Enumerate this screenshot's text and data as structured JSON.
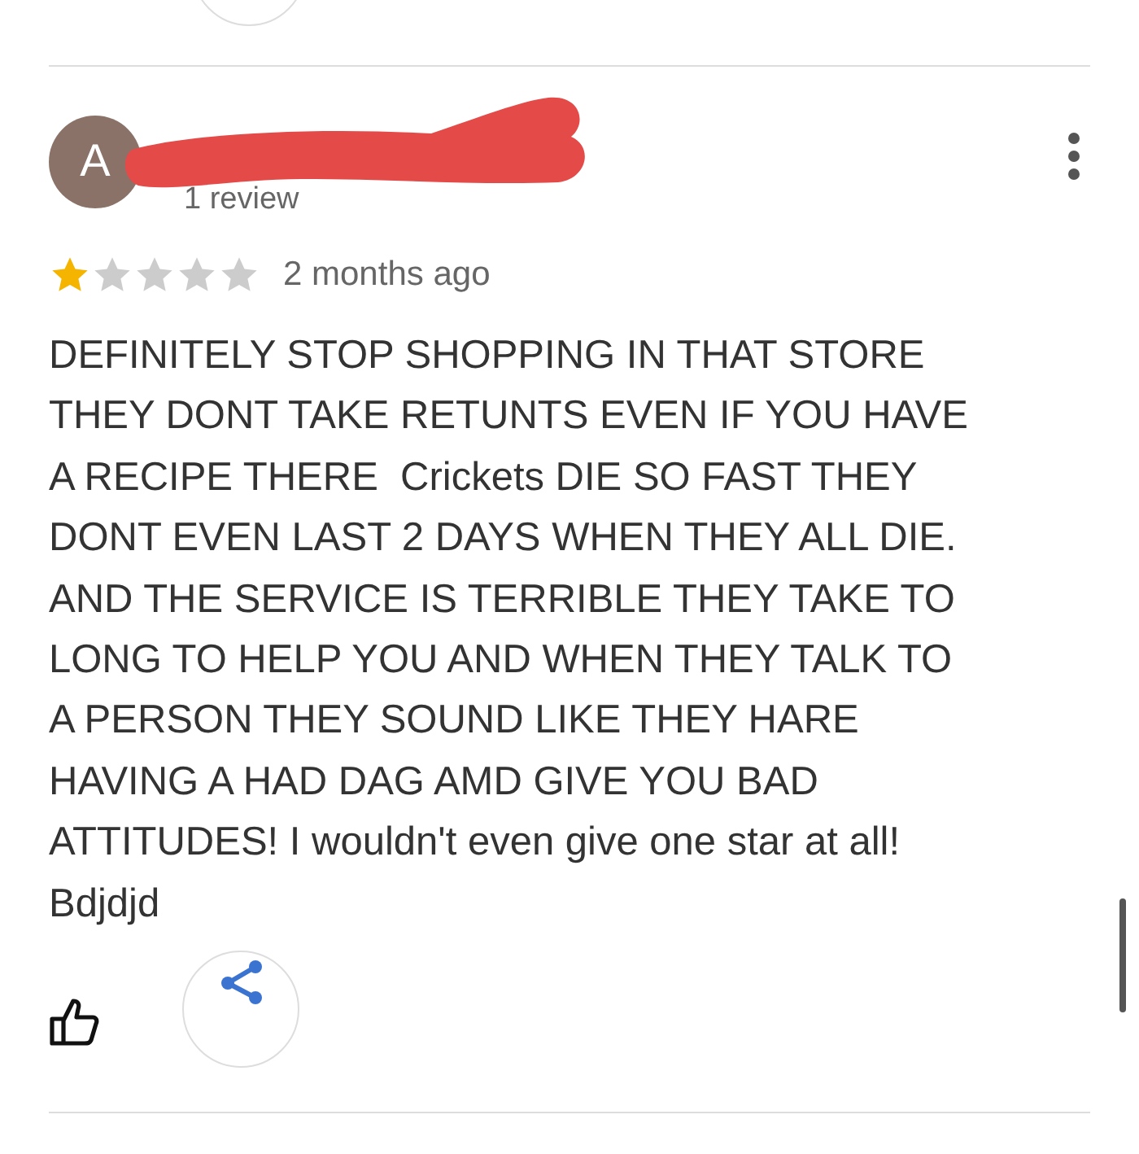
{
  "review": {
    "avatar_letter": "A",
    "review_count": "1 review",
    "stars": 1,
    "time": "2 months ago",
    "text": "DEFINITELY STOP SHOPPING IN THAT STORE\nTHEY DONT TAKE RETUNTS EVEN IF YOU HAVE\nA RECIPE THERE  Crickets DIE SO FAST THEY\nDONT EVEN LAST 2 DAYS WHEN THEY ALL DIE.\nAND THE SERVICE IS TERRIBLE THEY TAKE TO\nLONG TO HELP YOU AND WHEN THEY TALK TO\nA PERSON THEY SOUND LIKE THEY HARE\nHAVING A HAD DAG AMD GIVE YOU BAD\nATTITUDES! I wouldn't even give one star at all!\nBdjdjd"
  }
}
